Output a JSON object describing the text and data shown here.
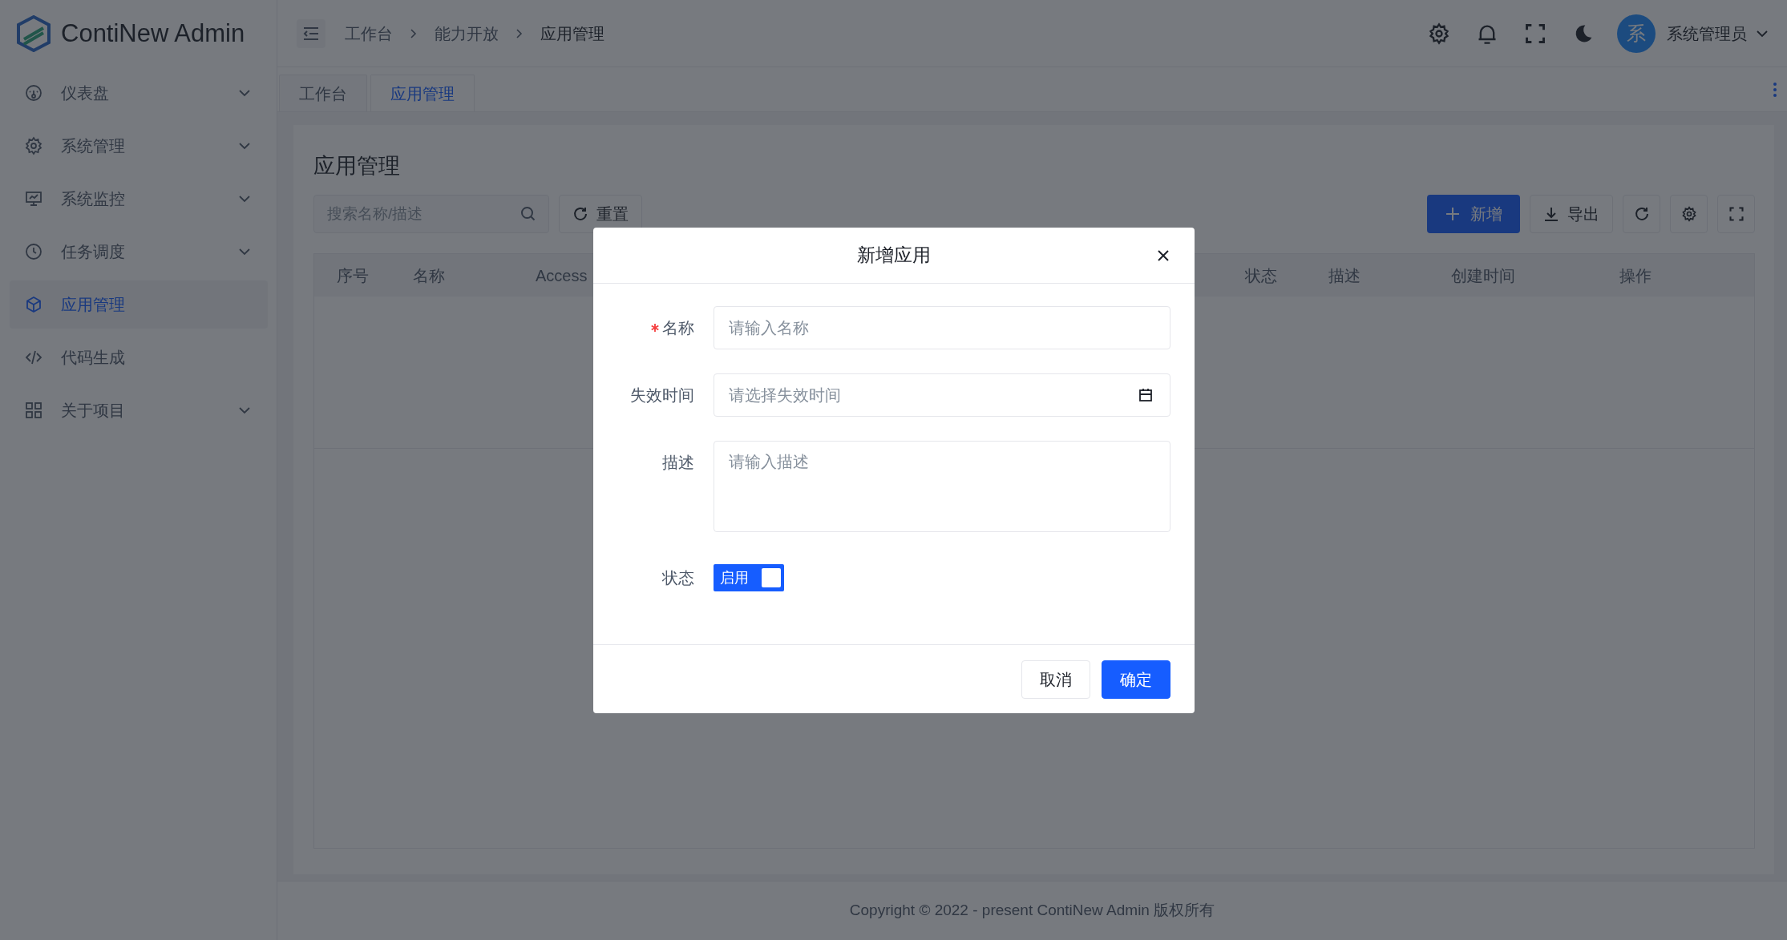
{
  "app": {
    "logo_text": "ContiNew Admin"
  },
  "sidebar": {
    "items": [
      {
        "label": "仪表盘",
        "kind": "submenu",
        "selected": false
      },
      {
        "label": "系统管理",
        "kind": "submenu",
        "selected": false
      },
      {
        "label": "系统监控",
        "kind": "submenu",
        "selected": false
      },
      {
        "label": "任务调度",
        "kind": "submenu",
        "selected": false
      },
      {
        "label": "应用管理",
        "kind": "item",
        "selected": true
      },
      {
        "label": "代码生成",
        "kind": "item",
        "selected": false
      },
      {
        "label": "关于项目",
        "kind": "submenu",
        "selected": false
      }
    ]
  },
  "header": {
    "breadcrumb": [
      "工作台",
      "能力开放",
      "应用管理"
    ],
    "user": {
      "avatar_text": "系",
      "name": "系统管理员"
    }
  },
  "tabs": [
    {
      "label": "工作台",
      "selected": false
    },
    {
      "label": "应用管理",
      "selected": true
    }
  ],
  "page": {
    "title": "应用管理",
    "search": {
      "placeholder": "搜索名称/描述"
    },
    "reset_button": "重置",
    "add_button": "新增",
    "export_button": "导出",
    "table": {
      "columns": [
        "序号",
        "名称",
        "Access",
        "状态",
        "描述",
        "创建时间",
        "操作"
      ]
    }
  },
  "modal": {
    "title": "新增应用",
    "fields": [
      {
        "label": "名称",
        "required": true,
        "kind": "text",
        "placeholder": "请输入名称"
      },
      {
        "label": "失效时间",
        "required": false,
        "kind": "date",
        "placeholder": "请选择失效时间"
      },
      {
        "label": "描述",
        "required": false,
        "kind": "textarea",
        "placeholder": "请输入描述"
      },
      {
        "label": "状态",
        "required": false,
        "kind": "switch",
        "on": true,
        "text": "启用"
      }
    ],
    "buttons": [
      {
        "label": "取消",
        "kind": "secondary"
      },
      {
        "label": "确定",
        "kind": "primary"
      }
    ]
  },
  "footer": {
    "text": "Copyright © 2022 - present ContiNew Admin 版权所有"
  }
}
